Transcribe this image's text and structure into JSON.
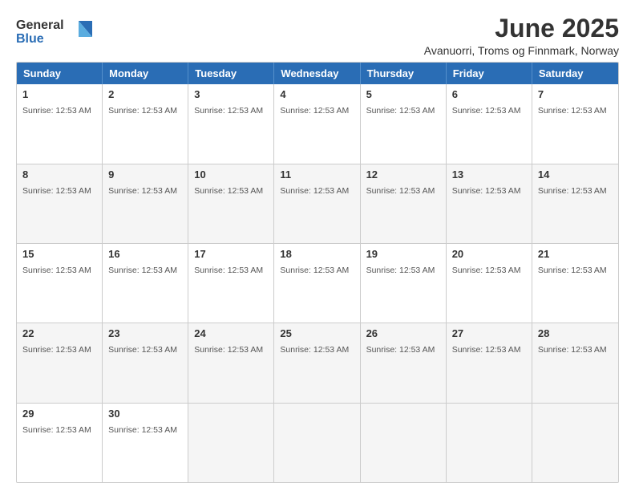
{
  "logo": {
    "line1": "General",
    "line2": "Blue"
  },
  "title": {
    "month_year": "June 2025",
    "location": "Avanuorri, Troms og Finnmark, Norway"
  },
  "calendar": {
    "headers": [
      "Sunday",
      "Monday",
      "Tuesday",
      "Wednesday",
      "Thursday",
      "Friday",
      "Saturday"
    ],
    "sunrise_text": "Sunrise: 12:53 AM",
    "weeks": [
      {
        "days": [
          {
            "date": "1",
            "sunrise": "Sunrise: 12:53 AM",
            "empty": false
          },
          {
            "date": "2",
            "sunrise": "Sunrise: 12:53 AM",
            "empty": false
          },
          {
            "date": "3",
            "sunrise": "Sunrise: 12:53 AM",
            "empty": false
          },
          {
            "date": "4",
            "sunrise": "Sunrise: 12:53 AM",
            "empty": false
          },
          {
            "date": "5",
            "sunrise": "Sunrise: 12:53 AM",
            "empty": false
          },
          {
            "date": "6",
            "sunrise": "Sunrise: 12:53 AM",
            "empty": false
          },
          {
            "date": "7",
            "sunrise": "Sunrise: 12:53 AM",
            "empty": false
          }
        ]
      },
      {
        "days": [
          {
            "date": "8",
            "sunrise": "Sunrise: 12:53 AM",
            "empty": false
          },
          {
            "date": "9",
            "sunrise": "Sunrise: 12:53 AM",
            "empty": false
          },
          {
            "date": "10",
            "sunrise": "Sunrise: 12:53 AM",
            "empty": false
          },
          {
            "date": "11",
            "sunrise": "Sunrise: 12:53 AM",
            "empty": false
          },
          {
            "date": "12",
            "sunrise": "Sunrise: 12:53 AM",
            "empty": false
          },
          {
            "date": "13",
            "sunrise": "Sunrise: 12:53 AM",
            "empty": false
          },
          {
            "date": "14",
            "sunrise": "Sunrise: 12:53 AM",
            "empty": false
          }
        ]
      },
      {
        "days": [
          {
            "date": "15",
            "sunrise": "Sunrise: 12:53 AM",
            "empty": false
          },
          {
            "date": "16",
            "sunrise": "Sunrise: 12:53 AM",
            "empty": false
          },
          {
            "date": "17",
            "sunrise": "Sunrise: 12:53 AM",
            "empty": false
          },
          {
            "date": "18",
            "sunrise": "Sunrise: 12:53 AM",
            "empty": false
          },
          {
            "date": "19",
            "sunrise": "Sunrise: 12:53 AM",
            "empty": false
          },
          {
            "date": "20",
            "sunrise": "Sunrise: 12:53 AM",
            "empty": false
          },
          {
            "date": "21",
            "sunrise": "Sunrise: 12:53 AM",
            "empty": false
          }
        ]
      },
      {
        "days": [
          {
            "date": "22",
            "sunrise": "Sunrise: 12:53 AM",
            "empty": false
          },
          {
            "date": "23",
            "sunrise": "Sunrise: 12:53 AM",
            "empty": false
          },
          {
            "date": "24",
            "sunrise": "Sunrise: 12:53 AM",
            "empty": false
          },
          {
            "date": "25",
            "sunrise": "Sunrise: 12:53 AM",
            "empty": false
          },
          {
            "date": "26",
            "sunrise": "Sunrise: 12:53 AM",
            "empty": false
          },
          {
            "date": "27",
            "sunrise": "Sunrise: 12:53 AM",
            "empty": false
          },
          {
            "date": "28",
            "sunrise": "Sunrise: 12:53 AM",
            "empty": false
          }
        ]
      },
      {
        "days": [
          {
            "date": "29",
            "sunrise": "Sunrise: 12:53 AM",
            "empty": false
          },
          {
            "date": "30",
            "sunrise": "Sunrise: 12:53 AM",
            "empty": false
          },
          {
            "date": "",
            "sunrise": "",
            "empty": true
          },
          {
            "date": "",
            "sunrise": "",
            "empty": true
          },
          {
            "date": "",
            "sunrise": "",
            "empty": true
          },
          {
            "date": "",
            "sunrise": "",
            "empty": true
          },
          {
            "date": "",
            "sunrise": "",
            "empty": true
          }
        ]
      }
    ]
  }
}
